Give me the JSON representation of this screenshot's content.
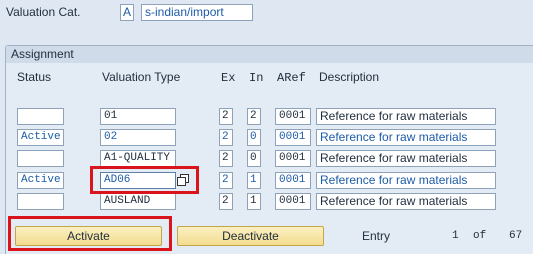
{
  "header": {
    "valuation_cat_label": "Valuation Cat.",
    "valuation_cat_code": "A",
    "valuation_cat_value": "s-indian/import"
  },
  "assignment": {
    "title": "Assignment",
    "columns": {
      "status": "Status",
      "valuation_type": "Valuation Type",
      "ex": "Ex",
      "in": "In",
      "aref": "ARef",
      "description": "Description"
    },
    "rows": [
      {
        "status": "",
        "valuation_type": "01",
        "ex": "2",
        "in": "2",
        "aref": "0001",
        "description": "Reference for raw materials"
      },
      {
        "status": "Active",
        "valuation_type": "02",
        "ex": "2",
        "in": "0",
        "aref": "0001",
        "description": "Reference for raw materials"
      },
      {
        "status": "",
        "valuation_type": "A1-QUALITY",
        "ex": "2",
        "in": "0",
        "aref": "0001",
        "description": "Reference for raw materials"
      },
      {
        "status": "Active",
        "valuation_type": "AD06",
        "ex": "2",
        "in": "1",
        "aref": "0001",
        "description": "Reference for raw materials"
      },
      {
        "status": "",
        "valuation_type": "AUSLAND",
        "ex": "2",
        "in": "1",
        "aref": "0001",
        "description": "Reference for raw materials"
      }
    ]
  },
  "footer": {
    "activate_label": "Activate",
    "deactivate_label": "Deactivate",
    "entry_label": "Entry",
    "entry_current": "1",
    "entry_of": "of",
    "entry_total": "67"
  },
  "colors": {
    "background": "#dfe8f2",
    "highlight": "#d9141b",
    "active_text": "#1c5ba8",
    "button": "#f3dc8f"
  }
}
